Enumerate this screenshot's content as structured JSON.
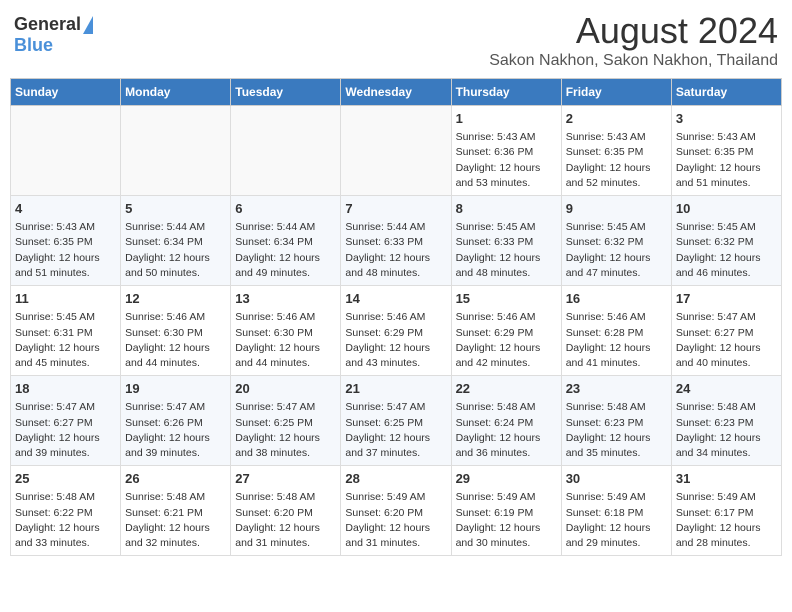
{
  "header": {
    "logo_general": "General",
    "logo_blue": "Blue",
    "title": "August 2024",
    "subtitle": "Sakon Nakhon, Sakon Nakhon, Thailand"
  },
  "weekdays": [
    "Sunday",
    "Monday",
    "Tuesday",
    "Wednesday",
    "Thursday",
    "Friday",
    "Saturday"
  ],
  "weeks": [
    [
      {
        "day": "",
        "info": ""
      },
      {
        "day": "",
        "info": ""
      },
      {
        "day": "",
        "info": ""
      },
      {
        "day": "",
        "info": ""
      },
      {
        "day": "1",
        "info": "Sunrise: 5:43 AM\nSunset: 6:36 PM\nDaylight: 12 hours\nand 53 minutes."
      },
      {
        "day": "2",
        "info": "Sunrise: 5:43 AM\nSunset: 6:35 PM\nDaylight: 12 hours\nand 52 minutes."
      },
      {
        "day": "3",
        "info": "Sunrise: 5:43 AM\nSunset: 6:35 PM\nDaylight: 12 hours\nand 51 minutes."
      }
    ],
    [
      {
        "day": "4",
        "info": "Sunrise: 5:43 AM\nSunset: 6:35 PM\nDaylight: 12 hours\nand 51 minutes."
      },
      {
        "day": "5",
        "info": "Sunrise: 5:44 AM\nSunset: 6:34 PM\nDaylight: 12 hours\nand 50 minutes."
      },
      {
        "day": "6",
        "info": "Sunrise: 5:44 AM\nSunset: 6:34 PM\nDaylight: 12 hours\nand 49 minutes."
      },
      {
        "day": "7",
        "info": "Sunrise: 5:44 AM\nSunset: 6:33 PM\nDaylight: 12 hours\nand 48 minutes."
      },
      {
        "day": "8",
        "info": "Sunrise: 5:45 AM\nSunset: 6:33 PM\nDaylight: 12 hours\nand 48 minutes."
      },
      {
        "day": "9",
        "info": "Sunrise: 5:45 AM\nSunset: 6:32 PM\nDaylight: 12 hours\nand 47 minutes."
      },
      {
        "day": "10",
        "info": "Sunrise: 5:45 AM\nSunset: 6:32 PM\nDaylight: 12 hours\nand 46 minutes."
      }
    ],
    [
      {
        "day": "11",
        "info": "Sunrise: 5:45 AM\nSunset: 6:31 PM\nDaylight: 12 hours\nand 45 minutes."
      },
      {
        "day": "12",
        "info": "Sunrise: 5:46 AM\nSunset: 6:30 PM\nDaylight: 12 hours\nand 44 minutes."
      },
      {
        "day": "13",
        "info": "Sunrise: 5:46 AM\nSunset: 6:30 PM\nDaylight: 12 hours\nand 44 minutes."
      },
      {
        "day": "14",
        "info": "Sunrise: 5:46 AM\nSunset: 6:29 PM\nDaylight: 12 hours\nand 43 minutes."
      },
      {
        "day": "15",
        "info": "Sunrise: 5:46 AM\nSunset: 6:29 PM\nDaylight: 12 hours\nand 42 minutes."
      },
      {
        "day": "16",
        "info": "Sunrise: 5:46 AM\nSunset: 6:28 PM\nDaylight: 12 hours\nand 41 minutes."
      },
      {
        "day": "17",
        "info": "Sunrise: 5:47 AM\nSunset: 6:27 PM\nDaylight: 12 hours\nand 40 minutes."
      }
    ],
    [
      {
        "day": "18",
        "info": "Sunrise: 5:47 AM\nSunset: 6:27 PM\nDaylight: 12 hours\nand 39 minutes."
      },
      {
        "day": "19",
        "info": "Sunrise: 5:47 AM\nSunset: 6:26 PM\nDaylight: 12 hours\nand 39 minutes."
      },
      {
        "day": "20",
        "info": "Sunrise: 5:47 AM\nSunset: 6:25 PM\nDaylight: 12 hours\nand 38 minutes."
      },
      {
        "day": "21",
        "info": "Sunrise: 5:47 AM\nSunset: 6:25 PM\nDaylight: 12 hours\nand 37 minutes."
      },
      {
        "day": "22",
        "info": "Sunrise: 5:48 AM\nSunset: 6:24 PM\nDaylight: 12 hours\nand 36 minutes."
      },
      {
        "day": "23",
        "info": "Sunrise: 5:48 AM\nSunset: 6:23 PM\nDaylight: 12 hours\nand 35 minutes."
      },
      {
        "day": "24",
        "info": "Sunrise: 5:48 AM\nSunset: 6:23 PM\nDaylight: 12 hours\nand 34 minutes."
      }
    ],
    [
      {
        "day": "25",
        "info": "Sunrise: 5:48 AM\nSunset: 6:22 PM\nDaylight: 12 hours\nand 33 minutes."
      },
      {
        "day": "26",
        "info": "Sunrise: 5:48 AM\nSunset: 6:21 PM\nDaylight: 12 hours\nand 32 minutes."
      },
      {
        "day": "27",
        "info": "Sunrise: 5:48 AM\nSunset: 6:20 PM\nDaylight: 12 hours\nand 31 minutes."
      },
      {
        "day": "28",
        "info": "Sunrise: 5:49 AM\nSunset: 6:20 PM\nDaylight: 12 hours\nand 31 minutes."
      },
      {
        "day": "29",
        "info": "Sunrise: 5:49 AM\nSunset: 6:19 PM\nDaylight: 12 hours\nand 30 minutes."
      },
      {
        "day": "30",
        "info": "Sunrise: 5:49 AM\nSunset: 6:18 PM\nDaylight: 12 hours\nand 29 minutes."
      },
      {
        "day": "31",
        "info": "Sunrise: 5:49 AM\nSunset: 6:17 PM\nDaylight: 12 hours\nand 28 minutes."
      }
    ]
  ]
}
